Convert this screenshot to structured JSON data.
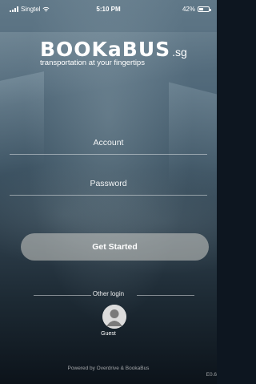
{
  "status_bar": {
    "carrier": "Singtel",
    "time": "5:10 PM",
    "battery_percent": "42%",
    "battery_level": 0.42,
    "signal_icon": "signal-bars-icon",
    "wifi_icon": "wifi-icon"
  },
  "brand": {
    "logo_main": "BOOKaBUS",
    "logo_suffix": ".sg",
    "tagline": "transportation at your fingertips"
  },
  "form": {
    "account_placeholder": "Account",
    "password_placeholder": "Password",
    "submit_label": "Get Started"
  },
  "other_login": {
    "heading": "Other login",
    "guest_label": "Guest",
    "guest_icon": "user-avatar-icon"
  },
  "footer": {
    "powered_by": "Powered by Overdrive & BookaBus",
    "version": "E0.6"
  },
  "colors": {
    "button_bg": "#cdcdc8",
    "text": "#ffffff"
  }
}
